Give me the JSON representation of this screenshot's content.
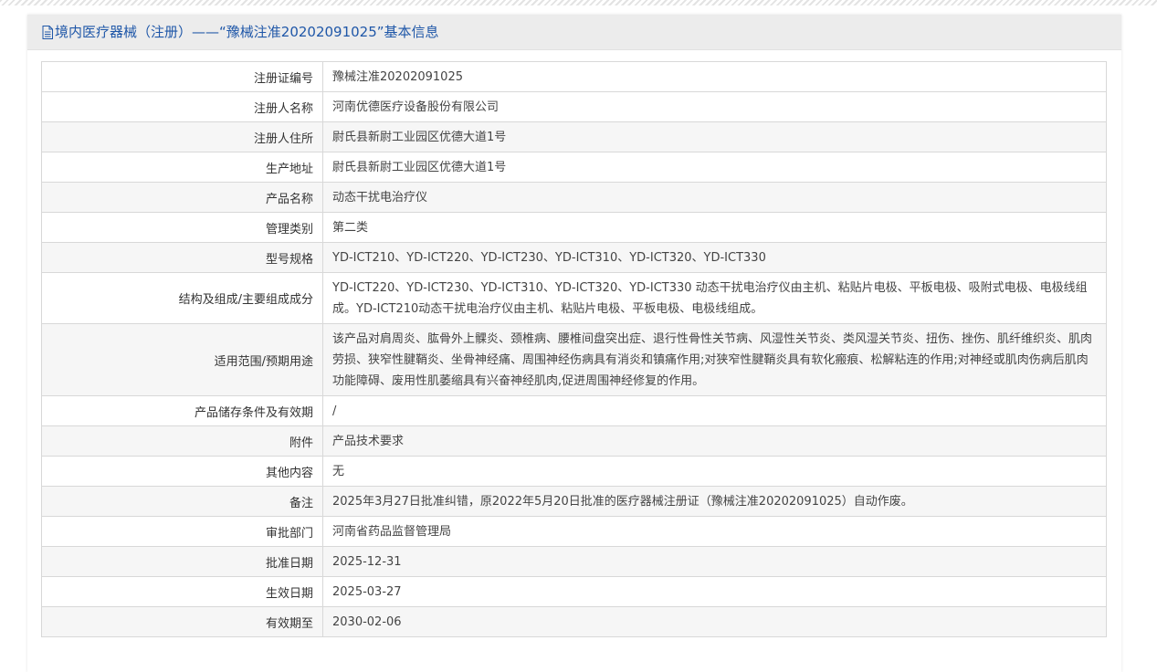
{
  "header": {
    "title": "境内医疗器械（注册）——“豫械注准20202091025”基本信息",
    "icon": "document-icon"
  },
  "colors": {
    "title": "#1f57a8",
    "header_bg": "#ececec",
    "row_alt_bg": "#f6f6f6",
    "border": "#d8d8d8"
  },
  "rows": [
    {
      "label": "注册证编号",
      "value": "豫械注准20202091025"
    },
    {
      "label": "注册人名称",
      "value": "河南优德医疗设备股份有限公司"
    },
    {
      "label": "注册人住所",
      "value": "尉氏县新尉工业园区优德大道1号"
    },
    {
      "label": "生产地址",
      "value": "尉氏县新尉工业园区优德大道1号"
    },
    {
      "label": "产品名称",
      "value": "动态干扰电治疗仪"
    },
    {
      "label": "管理类别",
      "value": "第二类"
    },
    {
      "label": "型号规格",
      "value": "YD-ICT210、YD-ICT220、YD-ICT230、YD-ICT310、YD-ICT320、YD-ICT330"
    },
    {
      "label": "结构及组成/主要组成成分",
      "value": "YD-ICT220、YD-ICT230、YD-ICT310、YD-ICT320、YD-ICT330 动态干扰电治疗仪由主机、粘贴片电极、平板电极、吸附式电极、电极线组成。YD-ICT210动态干扰电治疗仪由主机、粘贴片电极、平板电极、电极线组成。"
    },
    {
      "label": "适用范围/预期用途",
      "value": "该产品对肩周炎、肱骨外上髁炎、颈椎病、腰椎间盘突出症、退行性骨性关节病、风湿性关节炎、类风湿关节炎、扭伤、挫伤、肌纤维织炎、肌肉劳损、狭窄性腱鞘炎、坐骨神经痛、周围神经伤病具有消炎和镇痛作用;对狭窄性腱鞘炎具有软化瘢痕、松解粘连的作用;对神经或肌肉伤病后肌肉功能障碍、废用性肌萎缩具有兴奋神经肌肉,促进周围神经修复的作用。"
    },
    {
      "label": "产品储存条件及有效期",
      "value": "/"
    },
    {
      "label": "附件",
      "value": "产品技术要求"
    },
    {
      "label": "其他内容",
      "value": "无"
    },
    {
      "label": "备注",
      "value": "2025年3月27日批准纠错，原2022年5月20日批准的医疗器械注册证（豫械注准20202091025）自动作废。"
    },
    {
      "label": "审批部门",
      "value": "河南省药品监督管理局"
    },
    {
      "label": "批准日期",
      "value": "2025-12-31"
    },
    {
      "label": "生效日期",
      "value": "2025-03-27"
    },
    {
      "label": "有效期至",
      "value": "2030-02-06"
    }
  ]
}
